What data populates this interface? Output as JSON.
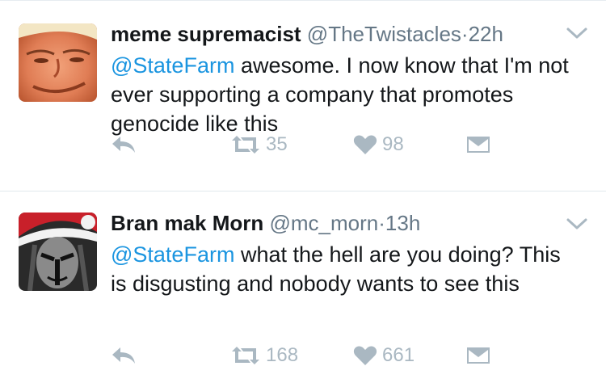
{
  "tweets": [
    {
      "name": "meme supremacist",
      "handle": "@TheTwistacles",
      "separator": "·",
      "time": "22h",
      "mention": "@StateFarm",
      "text": " awesome. I now know that I'm not ever supporting a company that promotes genocide like this",
      "retweets": "35",
      "likes": "98"
    },
    {
      "name": "Bran mak Morn",
      "handle": "@mc_morn",
      "separator": "·",
      "time": "13h",
      "mention": "@StateFarm",
      "text": " what the hell are you doing? This is disgusting and nobody wants to see this",
      "retweets": "168",
      "likes": "661"
    }
  ],
  "colors": {
    "mention": "#1b95e0",
    "secondary": "#657786",
    "icon": "#aab8c2"
  },
  "icons": [
    "reply-icon",
    "retweet-icon",
    "heart-icon",
    "envelope-icon",
    "chevron-down-icon"
  ]
}
